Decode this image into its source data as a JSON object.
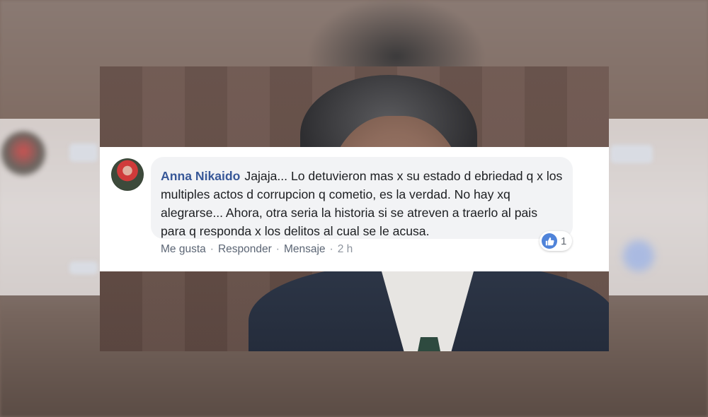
{
  "comment": {
    "author": "Anna Nikaido",
    "text": "Jajaja... Lo detuvieron mas x su estado d ebriedad q x los multiples actos d corrupcion q cometio, es la verdad. No hay xq alegrarse... Ahora, otra seria la historia si se atreven a traerlo al pais para q responda x los delitos al cual se le acusa.",
    "reaction_count": "1",
    "reaction_icon": "thumbs-up-icon",
    "actions": {
      "like": "Me gusta",
      "reply": "Responder",
      "message": "Mensaje",
      "separator": "·",
      "time": "2 h"
    }
  },
  "colors": {
    "author": "#385898",
    "bubble": "#f2f3f5",
    "like_blue": "#4f83d9"
  }
}
